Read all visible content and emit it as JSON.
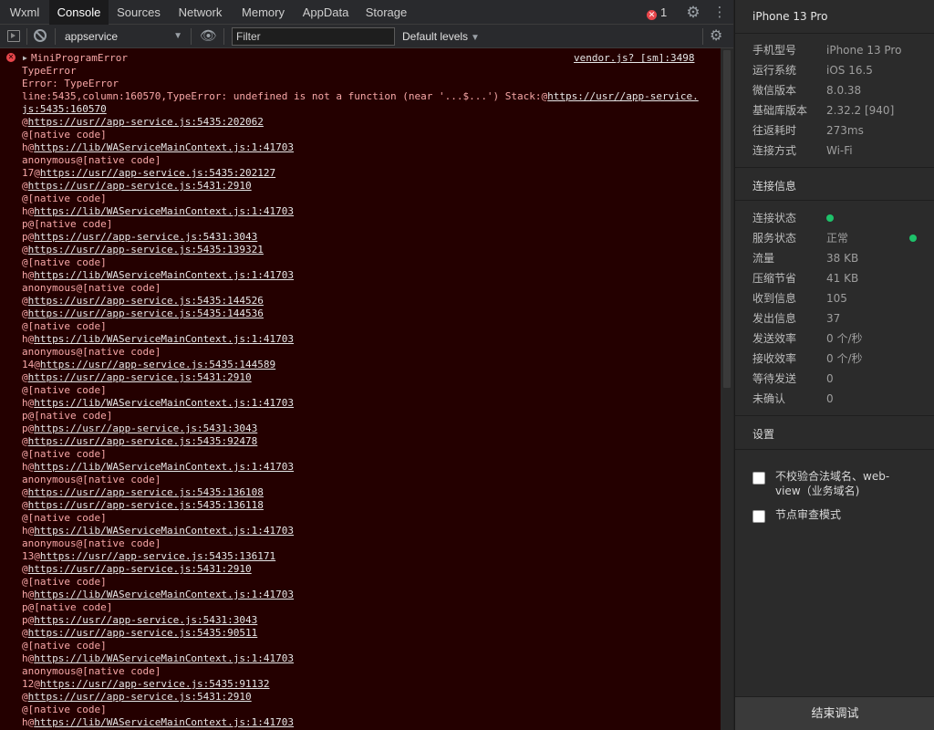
{
  "tabs": [
    "Wxml",
    "Console",
    "Sources",
    "Network",
    "Memory",
    "AppData",
    "Storage"
  ],
  "active_tab": "Console",
  "error_count": "1",
  "icons": {
    "settings": "gear-icon",
    "more": "vertical-dots-icon",
    "sidebar": "sidebar-toggle-icon",
    "clear": "clear-console-icon",
    "eye": "eye-icon",
    "error": "error-circle-icon"
  },
  "toolbar": {
    "context": "appservice",
    "filter_placeholder": "Filter",
    "levels": "Default levels"
  },
  "console": {
    "error_title": "MiniProgramError",
    "source": "vendor.js? [sm]:3498",
    "lines": [
      {
        "pre": "TypeError"
      },
      {
        "pre": "Error: TypeError"
      },
      {
        "pre": "line:5435,column:160570,TypeError: undefined is not a function (near '...$...') Stack:@",
        "link": "https://usr//app-service."
      },
      {
        "pre": "",
        "link": "js:5435:160570"
      },
      {
        "pre": "@",
        "link": "https://usr//app-service.js:5435:202062"
      },
      {
        "pre": "@[native code]"
      },
      {
        "pre": "h@",
        "link": "https://lib/WAServiceMainContext.js:1:41703"
      },
      {
        "pre": "anonymous@[native code]"
      },
      {
        "pre": "17@",
        "link": "https://usr//app-service.js:5435:202127"
      },
      {
        "pre": "@",
        "link": "https://usr//app-service.js:5431:2910"
      },
      {
        "pre": "@[native code]"
      },
      {
        "pre": "h@",
        "link": "https://lib/WAServiceMainContext.js:1:41703"
      },
      {
        "pre": "p@[native code]"
      },
      {
        "pre": "p@",
        "link": "https://usr//app-service.js:5431:3043"
      },
      {
        "pre": "@",
        "link": "https://usr//app-service.js:5435:139321"
      },
      {
        "pre": "@[native code]"
      },
      {
        "pre": "h@",
        "link": "https://lib/WAServiceMainContext.js:1:41703"
      },
      {
        "pre": "anonymous@[native code]"
      },
      {
        "pre": "@",
        "link": "https://usr//app-service.js:5435:144526"
      },
      {
        "pre": "@",
        "link": "https://usr//app-service.js:5435:144536"
      },
      {
        "pre": "@[native code]"
      },
      {
        "pre": "h@",
        "link": "https://lib/WAServiceMainContext.js:1:41703"
      },
      {
        "pre": "anonymous@[native code]"
      },
      {
        "pre": "14@",
        "link": "https://usr//app-service.js:5435:144589"
      },
      {
        "pre": "@",
        "link": "https://usr//app-service.js:5431:2910"
      },
      {
        "pre": "@[native code]"
      },
      {
        "pre": "h@",
        "link": "https://lib/WAServiceMainContext.js:1:41703"
      },
      {
        "pre": "p@[native code]"
      },
      {
        "pre": "p@",
        "link": "https://usr//app-service.js:5431:3043"
      },
      {
        "pre": "@",
        "link": "https://usr//app-service.js:5435:92478"
      },
      {
        "pre": "@[native code]"
      },
      {
        "pre": "h@",
        "link": "https://lib/WAServiceMainContext.js:1:41703"
      },
      {
        "pre": "anonymous@[native code]"
      },
      {
        "pre": "@",
        "link": "https://usr//app-service.js:5435:136108"
      },
      {
        "pre": "@",
        "link": "https://usr//app-service.js:5435:136118"
      },
      {
        "pre": "@[native code]"
      },
      {
        "pre": "h@",
        "link": "https://lib/WAServiceMainContext.js:1:41703"
      },
      {
        "pre": "anonymous@[native code]"
      },
      {
        "pre": "13@",
        "link": "https://usr//app-service.js:5435:136171"
      },
      {
        "pre": "@",
        "link": "https://usr//app-service.js:5431:2910"
      },
      {
        "pre": "@[native code]"
      },
      {
        "pre": "h@",
        "link": "https://lib/WAServiceMainContext.js:1:41703"
      },
      {
        "pre": "p@[native code]"
      },
      {
        "pre": "p@",
        "link": "https://usr//app-service.js:5431:3043"
      },
      {
        "pre": "@",
        "link": "https://usr//app-service.js:5435:90511"
      },
      {
        "pre": "@[native code]"
      },
      {
        "pre": "h@",
        "link": "https://lib/WAServiceMainContext.js:1:41703"
      },
      {
        "pre": "anonymous@[native code]"
      },
      {
        "pre": "12@",
        "link": "https://usr//app-service.js:5435:91132"
      },
      {
        "pre": "@",
        "link": "https://usr//app-service.js:5431:2910"
      },
      {
        "pre": "@[native code]"
      },
      {
        "pre": "h@",
        "link": "https://lib/WAServiceMainContext.js:1:41703"
      }
    ]
  },
  "side": {
    "device_title": "iPhone 13 Pro",
    "device_info": [
      {
        "k": "手机型号",
        "v": "iPhone 13 Pro"
      },
      {
        "k": "运行系统",
        "v": "iOS 16.5"
      },
      {
        "k": "微信版本",
        "v": "8.0.38"
      },
      {
        "k": "基础库版本",
        "v": "2.32.2 [940]"
      },
      {
        "k": "往返耗时",
        "v": "273ms"
      },
      {
        "k": "连接方式",
        "v": "Wi-Fi"
      }
    ],
    "connection_title": "连接信息",
    "connection_info": [
      {
        "k": "连接状态",
        "v": ""
      },
      {
        "k": "服务状态",
        "v": "正常"
      },
      {
        "k": "流量",
        "v": "38 KB"
      },
      {
        "k": "压缩节省",
        "v": "41 KB"
      },
      {
        "k": "收到信息",
        "v": "105"
      },
      {
        "k": "发出信息",
        "v": "37"
      },
      {
        "k": "发送效率",
        "v": "0 个/秒"
      },
      {
        "k": "接收效率",
        "v": "0 个/秒"
      },
      {
        "k": "等待发送",
        "v": "0"
      },
      {
        "k": "未确认",
        "v": "0"
      }
    ],
    "status_color": "#1ec26a",
    "settings_title": "设置",
    "options": [
      {
        "label": "不校验合法域名、web-view（业务域名)",
        "checked": false
      },
      {
        "label": "节点审查模式",
        "checked": false
      }
    ],
    "end_button": "结束调试"
  }
}
